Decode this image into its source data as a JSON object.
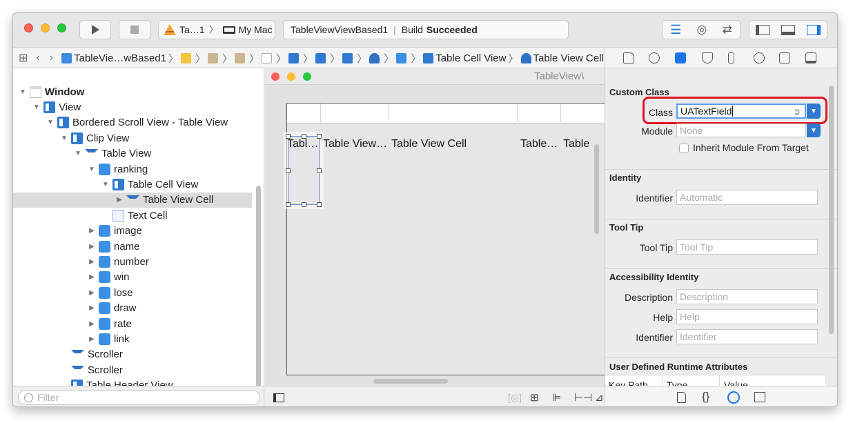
{
  "titlebar": {
    "scheme": "Ta…1",
    "destination": "My Mac",
    "status_project": "TableViewViewBased1",
    "status_prefix": "Build",
    "status_result": "Succeeded"
  },
  "jumpbar": {
    "items": [
      "TableVie…wBased1",
      "Table Cell View",
      "Table View Cell"
    ]
  },
  "outline": {
    "items": [
      {
        "label": "Window",
        "level": 0,
        "open": true,
        "icon": "window-icon",
        "bold": true
      },
      {
        "label": "View",
        "level": 1,
        "open": true,
        "icon": "view-icon"
      },
      {
        "label": "Bordered Scroll View - Table View",
        "level": 2,
        "open": true,
        "icon": "view-icon"
      },
      {
        "label": "Clip View",
        "level": 3,
        "open": true,
        "icon": "view-icon"
      },
      {
        "label": "Table View",
        "level": 4,
        "open": true,
        "icon": "table-icon"
      },
      {
        "label": "ranking",
        "level": 5,
        "open": true,
        "icon": "cube-icon"
      },
      {
        "label": "Table Cell View",
        "level": 6,
        "open": true,
        "icon": "view-icon"
      },
      {
        "label": "Table View Cell",
        "level": 7,
        "open": false,
        "icon": "table-icon",
        "selected": true
      },
      {
        "label": "Text Cell",
        "level": 6,
        "icon": "textcell-icon"
      },
      {
        "label": "image",
        "level": 5,
        "open": false,
        "icon": "cube-icon"
      },
      {
        "label": "name",
        "level": 5,
        "open": false,
        "icon": "cube-icon"
      },
      {
        "label": "number",
        "level": 5,
        "open": false,
        "icon": "cube-icon"
      },
      {
        "label": "win",
        "level": 5,
        "open": false,
        "icon": "cube-icon"
      },
      {
        "label": "lose",
        "level": 5,
        "open": false,
        "icon": "cube-icon"
      },
      {
        "label": "draw",
        "level": 5,
        "open": false,
        "icon": "cube-icon"
      },
      {
        "label": "rate",
        "level": 5,
        "open": false,
        "icon": "cube-icon"
      },
      {
        "label": "link",
        "level": 5,
        "open": false,
        "icon": "cube-icon"
      },
      {
        "label": "Scroller",
        "level": 3,
        "icon": "table-icon"
      },
      {
        "label": "Scroller",
        "level": 3,
        "icon": "table-icon"
      },
      {
        "label": "Table Header View",
        "level": 3,
        "icon": "view-icon"
      }
    ],
    "filter_placeholder": "Filter"
  },
  "canvas": {
    "window_title": "TableView\\",
    "cells": [
      "Tabl…",
      "Table View…",
      "Table View Cell",
      "Table…",
      "Table"
    ]
  },
  "inspector": {
    "custom_class": {
      "header": "Custom Class",
      "class_label": "Class",
      "class_value": "UATextField",
      "module_label": "Module",
      "module_placeholder": "None",
      "inherit_label": "Inherit Module From Target"
    },
    "identity": {
      "header": "Identity",
      "identifier_label": "Identifier",
      "identifier_placeholder": "Automatic"
    },
    "tooltip": {
      "header": "Tool Tip",
      "label": "Tool Tip",
      "placeholder": "Tool Tip"
    },
    "accessibility": {
      "header": "Accessibility Identity",
      "description_label": "Description",
      "description_placeholder": "Description",
      "help_label": "Help",
      "help_placeholder": "Help",
      "identifier_label": "Identifier",
      "identifier_placeholder": "Identifier"
    },
    "runtime": {
      "header": "User Defined Runtime Attributes",
      "columns": [
        "Key Path",
        "Type",
        "Value"
      ]
    }
  },
  "colors": {
    "accent": "#2f7ad0",
    "highlight_ring": "#e0141e",
    "close": "#fe5f57",
    "minimize": "#febc2e",
    "zoom": "#28c840"
  }
}
